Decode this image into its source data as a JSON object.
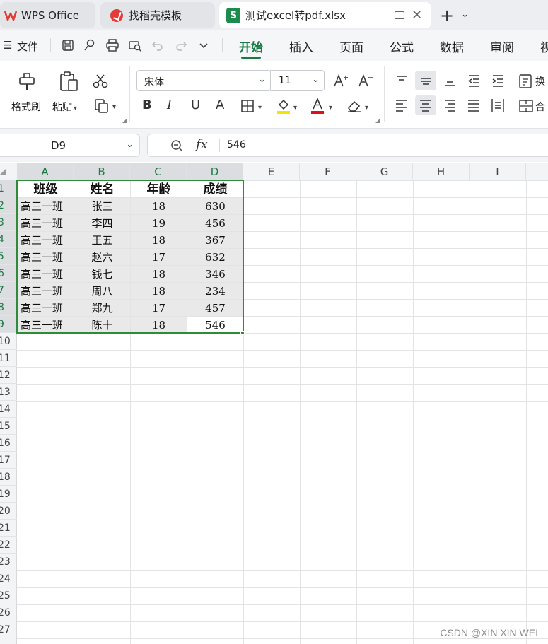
{
  "tabs": {
    "wps": "WPS Office",
    "daoke": "找稻壳模板",
    "excel": "测试excel转pdf.xlsx",
    "new_tab": "+"
  },
  "menu": {
    "hamburger": "☰",
    "file": "文件",
    "tabs": [
      "开始",
      "插入",
      "页面",
      "公式",
      "数据",
      "审阅",
      "视"
    ]
  },
  "ribbon": {
    "format_painter": "格式刷",
    "paste": "粘贴",
    "font_name": "宋体",
    "font_size": "11",
    "wrap_partial": "换",
    "merge_partial": "合"
  },
  "formula_bar": {
    "cell_ref": "D9",
    "fx": "fx",
    "value": "546"
  },
  "sheet": {
    "columns": [
      "A",
      "B",
      "C",
      "D",
      "E",
      "F",
      "G",
      "H",
      "I"
    ],
    "rows": [
      "1",
      "2",
      "3",
      "4",
      "5",
      "6",
      "7",
      "8",
      "9",
      "10",
      "11",
      "12",
      "13",
      "14",
      "15",
      "16",
      "17",
      "18",
      "19",
      "20",
      "21",
      "22",
      "23",
      "24",
      "25",
      "26",
      "27"
    ],
    "header": [
      "班级",
      "姓名",
      "年龄",
      "成绩"
    ],
    "data": [
      [
        "高三一班",
        "张三",
        "18",
        "630"
      ],
      [
        "高三一班",
        "李四",
        "19",
        "456"
      ],
      [
        "高三一班",
        "王五",
        "18",
        "367"
      ],
      [
        "高三一班",
        "赵六",
        "17",
        "632"
      ],
      [
        "高三一班",
        "钱七",
        "18",
        "346"
      ],
      [
        "高三一班",
        "周八",
        "18",
        "234"
      ],
      [
        "高三一班",
        "郑九",
        "17",
        "457"
      ],
      [
        "高三一班",
        "陈十",
        "18",
        "546"
      ]
    ]
  },
  "watermark": "CSDN @XIN XIN WEI",
  "colors": {
    "accent": "#1a7a44",
    "selection": "#2f8a3a"
  }
}
